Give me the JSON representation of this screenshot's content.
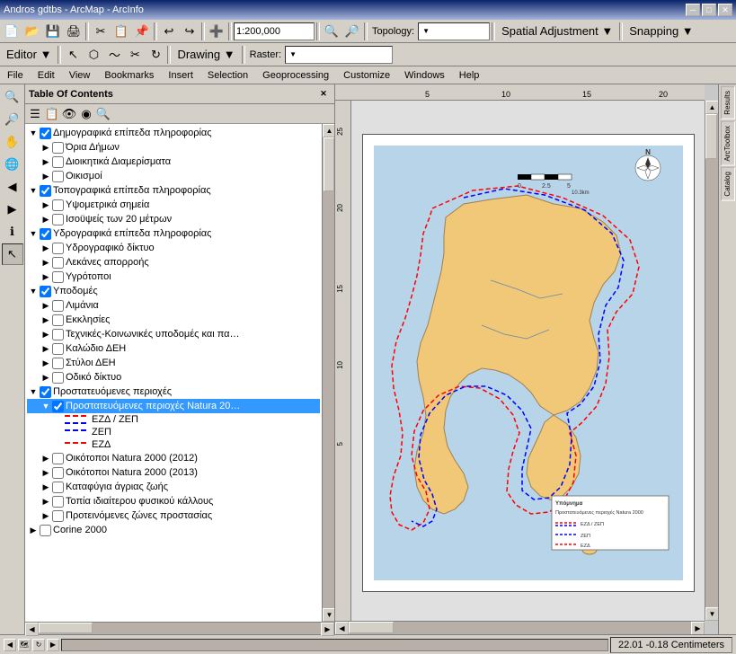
{
  "app": {
    "title": "Andros gdtbs - ArcMap - ArcInfo",
    "win_minimize": "─",
    "win_restore": "□",
    "win_close": "✕"
  },
  "toolbar1": {
    "scale": "1:200,000",
    "topology_label": "Topology:",
    "spatial_adjustment_label": "Spatial Adjustment ▼",
    "snapping_label": "Snapping ▼"
  },
  "toolbar2": {
    "editor_label": "Editor ▼",
    "drawing_label": "Drawing ▼",
    "raster_label": "Raster:"
  },
  "menubar": {
    "items": [
      "File",
      "Edit",
      "View",
      "Bookmarks",
      "Insert",
      "Selection",
      "Geoprocessing",
      "Customize",
      "Windows",
      "Help"
    ]
  },
  "toc": {
    "title": "Table Of Contents",
    "layers": [
      {
        "id": "demo",
        "indent": 0,
        "checked": true,
        "expanded": true,
        "label": "Δημογραφικά επίπεδα πληροφορίας"
      },
      {
        "id": "oria",
        "indent": 1,
        "checked": false,
        "expanded": false,
        "label": "Όρια Δήμων"
      },
      {
        "id": "dioik",
        "indent": 1,
        "checked": false,
        "expanded": false,
        "label": "Διοικητικά Διαμερίσματα"
      },
      {
        "id": "oikismoi",
        "indent": 1,
        "checked": false,
        "expanded": false,
        "label": "Οικισμοί"
      },
      {
        "id": "topo",
        "indent": 0,
        "checked": true,
        "expanded": true,
        "label": "Τοπογραφικά επίπεδα πληροφορίας"
      },
      {
        "id": "ypsom",
        "indent": 1,
        "checked": false,
        "expanded": false,
        "label": "Υψομετρικά σημεία"
      },
      {
        "id": "isoyp",
        "indent": 1,
        "checked": false,
        "expanded": false,
        "label": "Ισοϋψείς των 20 μέτρων"
      },
      {
        "id": "ydro",
        "indent": 0,
        "checked": true,
        "expanded": true,
        "label": "Υδρογραφικά επίπεδα πληροφορίας"
      },
      {
        "id": "ydrodikt",
        "indent": 1,
        "checked": false,
        "expanded": false,
        "label": "Υδρογραφικό δίκτυο"
      },
      {
        "id": "lekanes",
        "indent": 1,
        "checked": false,
        "expanded": false,
        "label": "Λεκάνες απορροής"
      },
      {
        "id": "ygroto",
        "indent": 1,
        "checked": false,
        "expanded": false,
        "label": "Υγρότοποι"
      },
      {
        "id": "ypodom",
        "indent": 0,
        "checked": true,
        "expanded": true,
        "label": "Υποδομές"
      },
      {
        "id": "limania",
        "indent": 1,
        "checked": false,
        "expanded": false,
        "label": "Λιμάνια"
      },
      {
        "id": "ekklisies",
        "indent": 1,
        "checked": false,
        "expanded": false,
        "label": "Εκκλησίες"
      },
      {
        "id": "texnikes",
        "indent": 1,
        "checked": false,
        "expanded": false,
        "label": "Τεχνικές-Κοινωνικές υποδομές και πα…"
      },
      {
        "id": "kalodio",
        "indent": 1,
        "checked": false,
        "expanded": false,
        "label": "Καλώδιο ΔΕΗ"
      },
      {
        "id": "styloi",
        "indent": 1,
        "checked": false,
        "expanded": false,
        "label": "Στύλοι ΔΕΗ"
      },
      {
        "id": "odiko",
        "indent": 1,
        "checked": false,
        "expanded": false,
        "label": "Οδικό δίκτυο"
      },
      {
        "id": "prostateuo",
        "indent": 0,
        "checked": true,
        "expanded": true,
        "label": "Προστατευόμενες περιοχές"
      },
      {
        "id": "natura_sel",
        "indent": 1,
        "checked": true,
        "expanded": true,
        "label": "Προστατευόμενες περιοχές Natura 20…",
        "selected": true
      },
      {
        "id": "leg_ezd_zep",
        "indent": 2,
        "checked": false,
        "expanded": false,
        "label": "ΕΖΔ / ΖΕΠ",
        "legend": "dash-red-blue"
      },
      {
        "id": "leg_zep",
        "indent": 2,
        "checked": false,
        "expanded": false,
        "label": "ΖΕΠ",
        "legend": "dash-blue"
      },
      {
        "id": "leg_ezd",
        "indent": 2,
        "checked": false,
        "expanded": false,
        "label": "ΕΖΔ",
        "legend": "dash-red"
      },
      {
        "id": "oikotopoi2012",
        "indent": 1,
        "checked": false,
        "expanded": false,
        "label": "Οικότοποι Natura 2000 (2012)"
      },
      {
        "id": "oikotopoi2013",
        "indent": 1,
        "checked": false,
        "expanded": false,
        "label": "Οικότοποι Natura 2000 (2013)"
      },
      {
        "id": "katafygia",
        "indent": 1,
        "checked": false,
        "expanded": false,
        "label": "Καταφύγια άγριας ζωής"
      },
      {
        "id": "topia",
        "indent": 1,
        "checked": false,
        "expanded": false,
        "label": "Τοπία ιδιαίτερου φυσικού κάλλους"
      },
      {
        "id": "proeinomenes",
        "indent": 1,
        "checked": false,
        "expanded": false,
        "label": "Προτεινόμενες ζώνες προστασίας"
      },
      {
        "id": "corine",
        "indent": 0,
        "checked": false,
        "expanded": false,
        "label": "Corine 2000"
      }
    ]
  },
  "ruler": {
    "top_marks": [
      "5",
      "10",
      "15",
      "20"
    ],
    "left_marks": [
      "25",
      "20",
      "15",
      "10",
      "5"
    ]
  },
  "statusbar": {
    "left_text": "",
    "coords": "22.01  -0.18 Centimeters"
  },
  "right_panel": {
    "results_label": "Results",
    "arctoolbox_label": "ArcToolbox",
    "catalog_label": "Catalog"
  },
  "map": {
    "north_arrow": "N↑",
    "legend_title": "Υπόμνημα",
    "legend_items": [
      {
        "label": "Προστατευόμενες περιοχές Natura 2000",
        "type": "title"
      },
      {
        "label": "ΕΖΔ / ΖΕΠ",
        "type": "dash-red-blue"
      },
      {
        "label": "ΖΕΠ",
        "type": "dash-blue"
      },
      {
        "label": "ΕΖΔ",
        "type": "dash-red"
      }
    ]
  }
}
